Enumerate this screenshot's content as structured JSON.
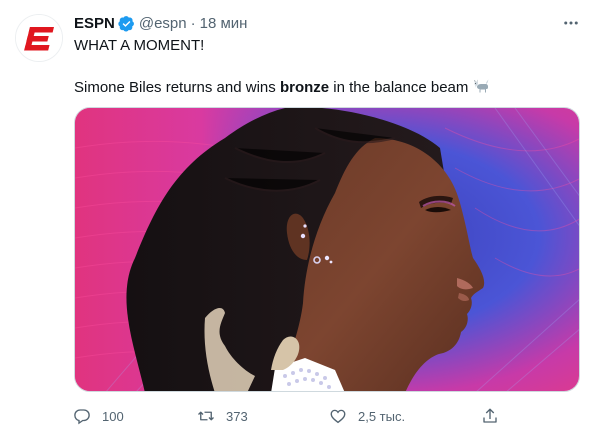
{
  "tweet": {
    "author_name": "ESPN",
    "handle": "@espn",
    "separator": "·",
    "time": "18 мин",
    "text_line1": "WHAT A MOMENT!",
    "text_line2_before": "Simone Biles returns and wins ",
    "text_line2_bold": "bronze",
    "text_line2_after": " in the balance beam",
    "emoji": "goat-emoji",
    "verified_color": "#1d9bf0"
  },
  "actions": {
    "reply_count": "100",
    "retweet_count": "373",
    "like_count": "2,5 тыс."
  },
  "icons": [
    "espn-logo-icon",
    "verified-badge-icon",
    "more-icon",
    "goat-emoji-icon",
    "reply-icon",
    "retweet-icon",
    "like-icon",
    "share-icon"
  ],
  "colors": {
    "brand": "#e0171f",
    "muted": "#536471",
    "text": "#0f1419"
  }
}
